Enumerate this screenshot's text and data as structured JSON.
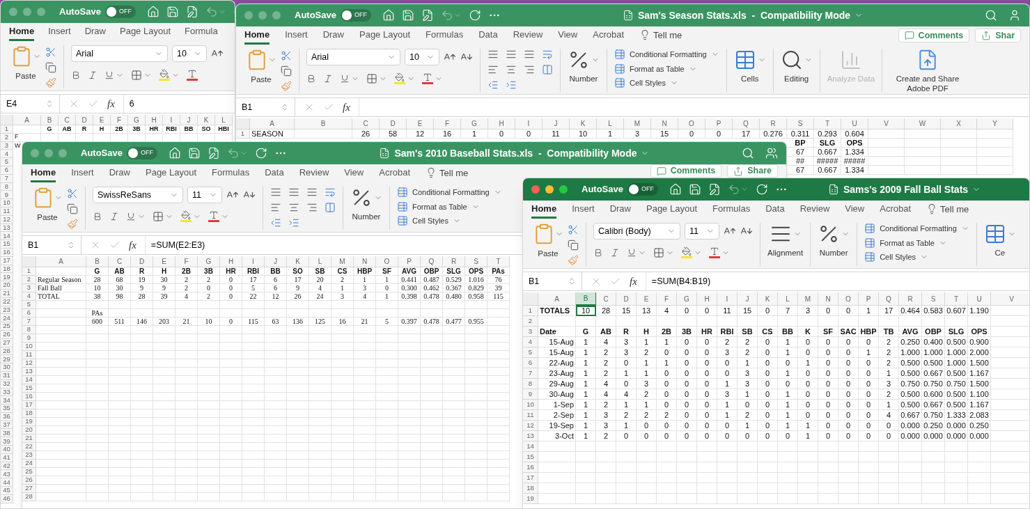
{
  "windows": [
    {
      "active": false,
      "autosave": {
        "label": "AutoSave",
        "on": false,
        "text": "OFF"
      },
      "tabs": [
        {
          "label": "Home",
          "selected": true
        },
        {
          "label": "Insert",
          "selected": false
        },
        {
          "label": "Draw",
          "selected": false
        },
        {
          "label": "Page Layout",
          "selected": false
        },
        {
          "label": "Formula",
          "selected": false
        }
      ],
      "ribbon": [
        {
          "kind": "clipboard",
          "label": "Paste"
        },
        {
          "kind": "font",
          "font": "Arial",
          "size": "10"
        }
      ],
      "name_box": "E4",
      "fx": "fx",
      "formula": "6",
      "grid": {
        "columns": [
          "A",
          "B",
          "C",
          "D",
          "E",
          "F",
          "G",
          "H",
          "I",
          "J",
          "K",
          "L"
        ],
        "rows": [
          {
            "number": "1",
            "bold": true,
            "cells": [
              "",
              "G",
              "AB",
              "R",
              "H",
              "2B",
              "3B",
              "HR",
              "RBI",
              "BB",
              "SO",
              "HBI"
            ]
          },
          {
            "number": "2",
            "cells": [
              "F"
            ]
          },
          {
            "number": "3",
            "cells": [
              "W"
            ]
          },
          {
            "number": "4"
          },
          {
            "number": "5"
          },
          {
            "number": "6"
          },
          {
            "number": "7"
          },
          {
            "number": "8"
          },
          {
            "number": "9"
          },
          {
            "number": "10"
          },
          {
            "number": "11"
          },
          {
            "number": "12"
          },
          {
            "number": "13"
          },
          {
            "number": "14"
          },
          {
            "number": "15"
          },
          {
            "number": "16"
          },
          {
            "number": "17"
          },
          {
            "number": "18"
          },
          {
            "number": "19"
          },
          {
            "number": "20"
          },
          {
            "number": "21"
          },
          {
            "number": "22"
          },
          {
            "number": "23"
          },
          {
            "number": "24"
          },
          {
            "number": "25"
          },
          {
            "number": "26"
          },
          {
            "number": "27"
          },
          {
            "number": "28"
          },
          {
            "number": "29"
          },
          {
            "number": "30"
          },
          {
            "number": "31"
          },
          {
            "number": "32"
          },
          {
            "number": "33"
          },
          {
            "number": "34"
          },
          {
            "number": "35"
          },
          {
            "number": "36"
          },
          {
            "number": "37"
          },
          {
            "number": "38"
          },
          {
            "number": "39"
          },
          {
            "number": "40"
          },
          {
            "number": "41"
          },
          {
            "number": "42"
          },
          {
            "number": "43"
          },
          {
            "number": "44"
          },
          {
            "number": "45"
          },
          {
            "number": "46"
          }
        ]
      }
    },
    {
      "active": false,
      "title": "Sam's Season Stats.xls  -  Compatibility Mode",
      "autosave": {
        "label": "AutoSave",
        "on": false,
        "text": "OFF"
      },
      "tabs": [
        {
          "label": "Home",
          "selected": true
        },
        {
          "label": "Insert",
          "selected": false
        },
        {
          "label": "Draw",
          "selected": false
        },
        {
          "label": "Page Layout",
          "selected": false
        },
        {
          "label": "Formulas",
          "selected": false
        },
        {
          "label": "Data",
          "selected": false
        },
        {
          "label": "Review",
          "selected": false
        },
        {
          "label": "View",
          "selected": false
        },
        {
          "label": "Acrobat",
          "selected": false
        }
      ],
      "tell_me": "Tell me",
      "comments": "Comments",
      "share": "Shar",
      "ribbon": [
        {
          "kind": "clipboard",
          "label": "Paste"
        },
        {
          "kind": "font",
          "font": "Arial",
          "size": "10"
        },
        {
          "kind": "align_icons"
        },
        {
          "kind": "number",
          "label": "Number"
        },
        {
          "kind": "styles",
          "items": [
            "Conditional Formatting",
            "Format as Table",
            "Cell Styles"
          ]
        },
        {
          "kind": "cells",
          "label": "Cells"
        },
        {
          "kind": "editing",
          "label": "Editing"
        },
        {
          "kind": "analyze",
          "label": "Analyze Data",
          "disabled": true
        },
        {
          "kind": "pdf",
          "label": "Create and Share Adobe PDF"
        }
      ],
      "name_box": "B1",
      "fx": "fx",
      "grid": {
        "columns": [
          "A",
          "B",
          "C",
          "D",
          "E",
          "F",
          "G",
          "H",
          "I",
          "J",
          "K",
          "L",
          "M",
          "N",
          "O",
          "P",
          "Q",
          "R",
          "S",
          "T",
          "U",
          "V",
          "W",
          "X",
          "Y"
        ],
        "rows": [
          {
            "number": "1",
            "cells": [
              "SEASON",
              "",
              "26",
              "58",
              "12",
              "16",
              "1",
              "0",
              "0",
              "11",
              "10",
              "1",
              "3",
              "15",
              "0",
              "0",
              "17",
              "0.276",
              "0.311",
              "0.293",
              "0.604"
            ]
          },
          {
            "bold": true,
            "cells": [
              "",
              "",
              "",
              "",
              "",
              "",
              "",
              "",
              "",
              "",
              "",
              "",
              "",
              "",
              "",
              "",
              "",
              "",
              "BP",
              "SLG",
              "OPS"
            ]
          },
          {
            "cells": [
              "",
              "",
              "",
              "",
              "",
              "",
              "",
              "",
              "",
              "",
              "",
              "",
              "",
              "",
              "",
              "",
              "",
              "",
              "67",
              "0.667",
              "1.334"
            ]
          },
          {
            "cells": [
              "",
              "",
              "",
              "",
              "",
              "",
              "",
              "",
              "",
              "",
              "",
              "",
              "",
              "",
              "",
              "",
              "",
              "",
              "##",
              "#####",
              "#####"
            ]
          },
          {
            "cells": [
              "",
              "",
              "",
              "",
              "",
              "",
              "",
              "",
              "",
              "",
              "",
              "",
              "",
              "",
              "",
              "",
              "",
              "",
              "67",
              "0.667",
              "1.334"
            ]
          }
        ]
      }
    },
    {
      "active": false,
      "title": "Sam's 2010 Baseball Stats.xls  -  Compatibility Mode",
      "autosave": {
        "label": "AutoSave",
        "on": false,
        "text": "OFF"
      },
      "tabs": [
        {
          "label": "Home",
          "selected": true
        },
        {
          "label": "Insert",
          "selected": false
        },
        {
          "label": "Draw",
          "selected": false
        },
        {
          "label": "Page Layout",
          "selected": false
        },
        {
          "label": "Formulas",
          "selected": false
        },
        {
          "label": "Data",
          "selected": false
        },
        {
          "label": "Review",
          "selected": false
        },
        {
          "label": "View",
          "selected": false
        },
        {
          "label": "Acrobat",
          "selected": false
        }
      ],
      "tell_me": "Tell me",
      "comments": "Comments",
      "share": "Share",
      "ribbon": [
        {
          "kind": "clipboard",
          "label": "Paste"
        },
        {
          "kind": "font",
          "font": "SwissReSans",
          "size": "11"
        },
        {
          "kind": "align_icons"
        },
        {
          "kind": "number",
          "label": "Number"
        },
        {
          "kind": "styles",
          "items": [
            "Conditional Formatting",
            "Format as Table",
            "Cell Styles"
          ]
        }
      ],
      "name_box": "B1",
      "fx": "fx",
      "formula": "=SUM(E2:E3)",
      "grid": {
        "columns": [
          "A",
          "B",
          "C",
          "D",
          "E",
          "F",
          "G",
          "H",
          "I",
          "J",
          "K",
          "L",
          "M",
          "N",
          "O",
          "P",
          "Q",
          "R",
          "S",
          "T"
        ],
        "rows": [
          {
            "number": "1",
            "bold": true,
            "cells": [
              "",
              "G",
              "AB",
              "R",
              "H",
              "2B",
              "3B",
              "HR",
              "RBI",
              "BB",
              "SO",
              "SB",
              "CS",
              "HBP",
              "SF",
              "AVG",
              "OBP",
              "SLG",
              "OPS",
              "PAs"
            ]
          },
          {
            "number": "2",
            "cells": [
              "Regular Season",
              "28",
              "68",
              "19",
              "30",
              "2",
              "2",
              "0",
              "17",
              "6",
              "17",
              "20",
              "2",
              "1",
              "1",
              "0.441",
              "0.487",
              "0.529",
              "1.016",
              "76"
            ]
          },
          {
            "number": "3",
            "cells": [
              "Fall Ball",
              "10",
              "30",
              "9",
              "9",
              "2",
              "0",
              "0",
              "5",
              "6",
              "9",
              "4",
              "1",
              "3",
              "0",
              "0.300",
              "0.462",
              "0.367",
              "0.829",
              "39"
            ]
          },
          {
            "number": "4",
            "cells": [
              "TOTAL",
              "38",
              "98",
              "28",
              "39",
              "4",
              "2",
              "0",
              "22",
              "12",
              "26",
              "24",
              "3",
              "4",
              "1",
              "0.398",
              "0.478",
              "0.480",
              "0.958",
              "115"
            ]
          },
          {
            "number": "5"
          },
          {
            "number": "6",
            "cells": [
              "",
              "PAs"
            ]
          },
          {
            "number": "7",
            "cells": [
              "",
              "600",
              "511",
              "146",
              "203",
              "21",
              "10",
              "0",
              "115",
              "63",
              "136",
              "125",
              "16",
              "21",
              "5",
              "0.397",
              "0.478",
              "0.477",
              "0.955"
            ]
          },
          {
            "number": "8"
          },
          {
            "number": "9"
          },
          {
            "number": "10"
          },
          {
            "number": "11"
          },
          {
            "number": "12"
          },
          {
            "number": "13"
          },
          {
            "number": "14"
          },
          {
            "number": "15"
          },
          {
            "number": "16"
          },
          {
            "number": "17"
          },
          {
            "number": "18"
          },
          {
            "number": "19"
          },
          {
            "number": "20"
          },
          {
            "number": "21"
          },
          {
            "number": "22"
          },
          {
            "number": "23"
          },
          {
            "number": "24"
          },
          {
            "number": "25"
          },
          {
            "number": "26"
          },
          {
            "number": "27"
          },
          {
            "number": "28"
          }
        ]
      }
    },
    {
      "active": true,
      "title": "Sams's 2009 Fall Ball Stats",
      "autosave": {
        "label": "AutoSave",
        "on": false,
        "text": "OFF"
      },
      "tabs": [
        {
          "label": "Home",
          "selected": true
        },
        {
          "label": "Insert",
          "selected": false
        },
        {
          "label": "Draw",
          "selected": false
        },
        {
          "label": "Page Layout",
          "selected": false
        },
        {
          "label": "Formulas",
          "selected": false
        },
        {
          "label": "Data",
          "selected": false
        },
        {
          "label": "Review",
          "selected": false
        },
        {
          "label": "View",
          "selected": false
        },
        {
          "label": "Acrobat",
          "selected": false
        }
      ],
      "tell_me": "Tell me",
      "ribbon": [
        {
          "kind": "clipboard",
          "label": "Paste"
        },
        {
          "kind": "font",
          "font": "Calibri (Body)",
          "size": "11"
        },
        {
          "kind": "align_menu",
          "label": "Alignment"
        },
        {
          "kind": "number",
          "label": "Number"
        },
        {
          "kind": "styles",
          "items": [
            "Conditional Formatting",
            "Format as Table",
            "Cell Styles"
          ]
        },
        {
          "kind": "cells",
          "label": "Ce"
        }
      ],
      "name_box": "B1",
      "fx": "fx",
      "formula": "=SUM(B4:B19)",
      "grid": {
        "columns": [
          {
            "label": "A",
            "selected": false
          },
          {
            "label": "B",
            "selected": true
          },
          {
            "label": "C",
            "selected": false
          },
          {
            "label": "D",
            "selected": false
          },
          {
            "label": "E",
            "selected": false
          },
          {
            "label": "F",
            "selected": false
          },
          {
            "label": "G",
            "selected": false
          },
          {
            "label": "H",
            "selected": false
          },
          {
            "label": "I",
            "selected": false
          },
          {
            "label": "J",
            "selected": false
          },
          {
            "label": "K",
            "selected": false
          },
          {
            "label": "L",
            "selected": false
          },
          {
            "label": "M",
            "selected": false
          },
          {
            "label": "N",
            "selected": false
          },
          {
            "label": "O",
            "selected": false
          },
          {
            "label": "P",
            "selected": false
          },
          {
            "label": "Q",
            "selected": false
          },
          {
            "label": "R",
            "selected": false
          },
          {
            "label": "S",
            "selected": false
          },
          {
            "label": "T",
            "selected": false
          },
          {
            "label": "U",
            "selected": false
          },
          {
            "label": "V",
            "selected": false
          }
        ],
        "rows": [
          {
            "number": "1",
            "cells": [
              {
                "text": "TOTALS",
                "bold": true
              },
              {
                "text": "10",
                "selected": true
              },
              "28",
              "15",
              "13",
              "4",
              "0",
              "0",
              "11",
              "15",
              "0",
              "7",
              "3",
              "0",
              "0",
              "1",
              "17",
              "0.464",
              "0.583",
              "0.607",
              "1.190"
            ]
          },
          {
            "number": "2"
          },
          {
            "number": "3",
            "bold": true,
            "cells": [
              "Date",
              "G",
              "AB",
              "R",
              "H",
              "2B",
              "3B",
              "HR",
              "RBI",
              "SB",
              "CS",
              "BB",
              "K",
              "SF",
              "SAC",
              "HBP",
              "TB",
              "AVG",
              "OBP",
              "SLG",
              "OPS"
            ]
          },
          {
            "number": "4",
            "cells": [
              "15-Aug",
              "1",
              "4",
              "3",
              "1",
              "1",
              "0",
              "0",
              "2",
              "2",
              "0",
              "1",
              "0",
              "0",
              "0",
              "0",
              "2",
              "0.250",
              "0.400",
              "0.500",
              "0.900"
            ]
          },
          {
            "number": "5",
            "cells": [
              "15-Aug",
              "1",
              "2",
              "3",
              "2",
              "0",
              "0",
              "0",
              "3",
              "2",
              "0",
              "1",
              "0",
              "0",
              "0",
              "1",
              "2",
              "1.000",
              "1.000",
              "1.000",
              "2.000"
            ]
          },
          {
            "number": "6",
            "cells": [
              "22-Aug",
              "1",
              "2",
              "0",
              "1",
              "1",
              "0",
              "0",
              "0",
              "1",
              "0",
              "0",
              "1",
              "0",
              "0",
              "0",
              "2",
              "0.500",
              "0.500",
              "1.000",
              "1.500"
            ]
          },
          {
            "number": "7",
            "cells": [
              "23-Aug",
              "1",
              "2",
              "1",
              "1",
              "0",
              "0",
              "0",
              "0",
              "3",
              "0",
              "1",
              "0",
              "0",
              "0",
              "0",
              "1",
              "0.500",
              "0.667",
              "0.500",
              "1.167"
            ]
          },
          {
            "number": "8",
            "cells": [
              "29-Aug",
              "1",
              "4",
              "0",
              "3",
              "0",
              "0",
              "0",
              "1",
              "3",
              "0",
              "0",
              "0",
              "0",
              "0",
              "0",
              "3",
              "0.750",
              "0.750",
              "0.750",
              "1.500"
            ]
          },
          {
            "number": "9",
            "cells": [
              "30-Aug",
              "1",
              "4",
              "4",
              "2",
              "0",
              "0",
              "0",
              "3",
              "1",
              "0",
              "1",
              "0",
              "0",
              "0",
              "0",
              "2",
              "0.500",
              "0.600",
              "0.500",
              "1.100"
            ]
          },
          {
            "number": "10",
            "cells": [
              "1-Sep",
              "1",
              "2",
              "1",
              "1",
              "0",
              "0",
              "0",
              "1",
              "0",
              "0",
              "1",
              "0",
              "0",
              "0",
              "0",
              "1",
              "0.500",
              "0.667",
              "0.500",
              "1.167"
            ]
          },
          {
            "number": "11",
            "cells": [
              "2-Sep",
              "1",
              "3",
              "2",
              "2",
              "2",
              "0",
              "0",
              "1",
              "2",
              "0",
              "1",
              "0",
              "0",
              "0",
              "0",
              "4",
              "0.667",
              "0.750",
              "1.333",
              "2.083"
            ]
          },
          {
            "number": "12",
            "cells": [
              "19-Sep",
              "1",
              "3",
              "1",
              "0",
              "0",
              "0",
              "0",
              "0",
              "1",
              "0",
              "1",
              "1",
              "0",
              "0",
              "0",
              "0",
              "0.000",
              "0.250",
              "0.000",
              "0.250"
            ]
          },
          {
            "number": "13",
            "cells": [
              "3-Oct",
              "1",
              "2",
              "0",
              "0",
              "0",
              "0",
              "0",
              "0",
              "0",
              "0",
              "0",
              "1",
              "0",
              "0",
              "0",
              "0",
              "0.000",
              "0.000",
              "0.000",
              "0.000"
            ]
          },
          {
            "number": "14"
          },
          {
            "number": "15"
          },
          {
            "number": "16"
          },
          {
            "number": "17"
          },
          {
            "number": "18"
          },
          {
            "number": "19"
          }
        ]
      }
    }
  ]
}
